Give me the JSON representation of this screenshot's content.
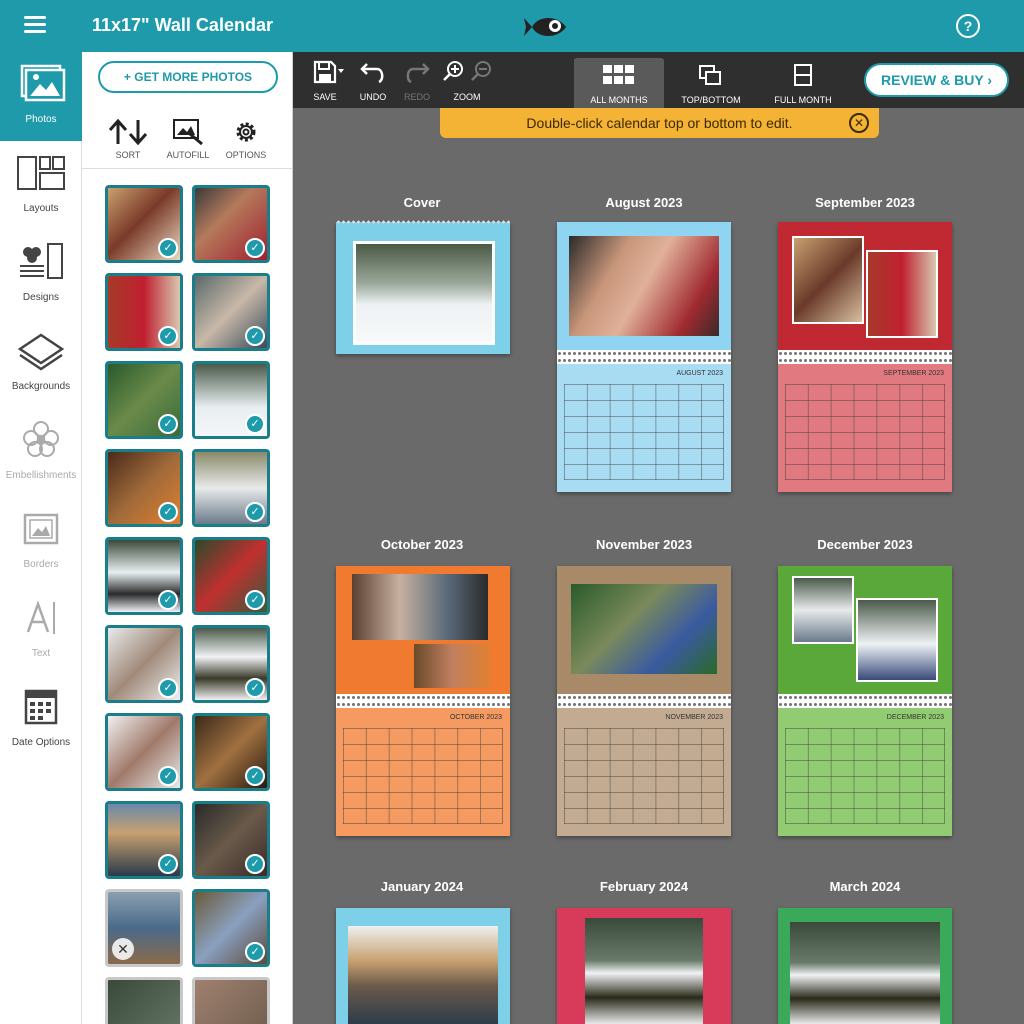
{
  "app": {
    "title": "11x17\" Wall Calendar",
    "help": "?"
  },
  "rail": [
    {
      "label": "Photos",
      "icon": "photos-icon"
    },
    {
      "label": "Layouts",
      "icon": "layouts-icon"
    },
    {
      "label": "Designs",
      "icon": "designs-icon"
    },
    {
      "label": "Backgrounds",
      "icon": "backgrounds-icon"
    },
    {
      "label": "Embellishments",
      "icon": "embellishments-icon"
    },
    {
      "label": "Borders",
      "icon": "borders-icon"
    },
    {
      "label": "Text",
      "icon": "text-icon"
    },
    {
      "label": "Date Options",
      "icon": "date-options-icon"
    }
  ],
  "panel": {
    "get_more": "+ GET MORE PHOTOS",
    "tools": [
      {
        "label": "SORT",
        "icon": "sort-icon"
      },
      {
        "label": "AUTOFILL",
        "icon": "autofill-icon"
      },
      {
        "label": "OPTIONS",
        "icon": "gear-icon"
      }
    ]
  },
  "toolbar": {
    "save": "SAVE",
    "undo": "UNDO",
    "redo": "REDO",
    "zoom": "ZOOM",
    "views": [
      "ALL MONTHS",
      "TOP/BOTTOM",
      "FULL MONTH"
    ],
    "review": "REVIEW & BUY"
  },
  "notice": {
    "text": "Double-click calendar top or bottom to edit."
  },
  "pages": [
    {
      "title": "Cover",
      "label": ""
    },
    {
      "title": "August 2023",
      "label": "AUGUST 2023"
    },
    {
      "title": "September 2023",
      "label": "SEPTEMBER 2023"
    },
    {
      "title": "October 2023",
      "label": "OCTOBER 2023"
    },
    {
      "title": "November 2023",
      "label": "NOVEMBER 2023"
    },
    {
      "title": "December 2023",
      "label": "DECEMBER 2023"
    },
    {
      "title": "January 2024",
      "label": ""
    },
    {
      "title": "February 2024",
      "label": ""
    },
    {
      "title": "March 2024",
      "label": ""
    }
  ],
  "colors": {
    "accent": "#1e9aaa",
    "notice": "#f5b335",
    "toolbar": "#2f2f2f",
    "canvas": "#6a6a6a"
  }
}
